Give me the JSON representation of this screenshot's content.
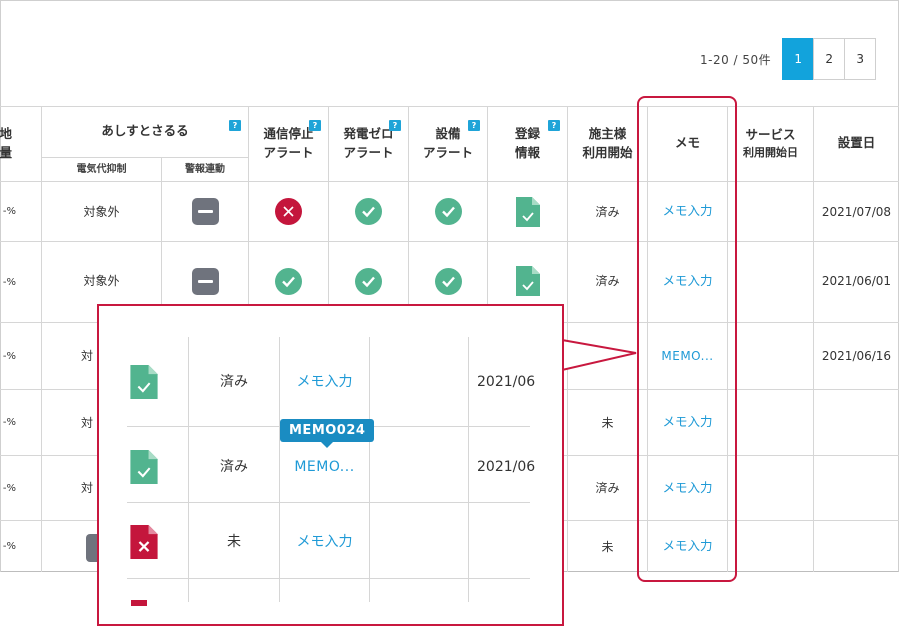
{
  "pager": {
    "summary": "1-20 / 50件",
    "pages": [
      "1",
      "2",
      "3"
    ],
    "active_page": "1"
  },
  "headers": {
    "col0_top": "地",
    "col0_bottom": "量",
    "group_ashisu": "あしすとさるる",
    "sub_denki": "電気代抑制",
    "sub_keiho": "警報連動",
    "tsushin": [
      "通信停止",
      "アラート"
    ],
    "hatsuden": [
      "発電ゼロ",
      "アラート"
    ],
    "setsubi": [
      "設備",
      "アラート"
    ],
    "toroku": [
      "登録",
      "情報"
    ],
    "seshu": [
      "施主様",
      "利用開始"
    ],
    "memo": "メモ",
    "service": [
      "サービス",
      "利用開始日"
    ],
    "setchi": "設置日",
    "help_mark": "?"
  },
  "rows": [
    {
      "pct": "-%",
      "denki": "対象外",
      "seshu": "済み",
      "memo": "メモ入力",
      "date": "2021/07/08",
      "tsushin": "ng"
    },
    {
      "pct": "-%",
      "denki": "対象外",
      "seshu": "済み",
      "memo": "メモ入力",
      "date": "2021/06/01",
      "tsushin": "ok"
    },
    {
      "pct": "-%",
      "denki": "対",
      "seshu": "",
      "memo": "MEMO...",
      "date": "2021/06/16"
    },
    {
      "pct": "-%",
      "denki": "対",
      "seshu": "未",
      "memo": "メモ入力",
      "date": ""
    },
    {
      "pct": "-%",
      "denki": "対",
      "seshu": "済み",
      "memo": "メモ入力",
      "date": ""
    },
    {
      "pct": "-%",
      "denki": "",
      "seshu": "未",
      "memo": "メモ入力",
      "date": ""
    }
  ],
  "zoom": {
    "rows": [
      {
        "seshu": "済み",
        "memo": "メモ入力",
        "date": "2021/06",
        "doc": "ok"
      },
      {
        "seshu": "済み",
        "memo": "MEMO...",
        "date": "2021/06",
        "doc": "ok"
      },
      {
        "seshu": "未",
        "memo": "メモ入力",
        "date": "",
        "doc": "ng"
      }
    ],
    "tooltip": "MEMO024"
  },
  "colors": {
    "accent": "#12a3dc",
    "link": "#1f9ad6",
    "highlight": "#c8183f",
    "ok": "#52b48f",
    "ng": "#c4163c",
    "neutral": "#6f737d"
  }
}
